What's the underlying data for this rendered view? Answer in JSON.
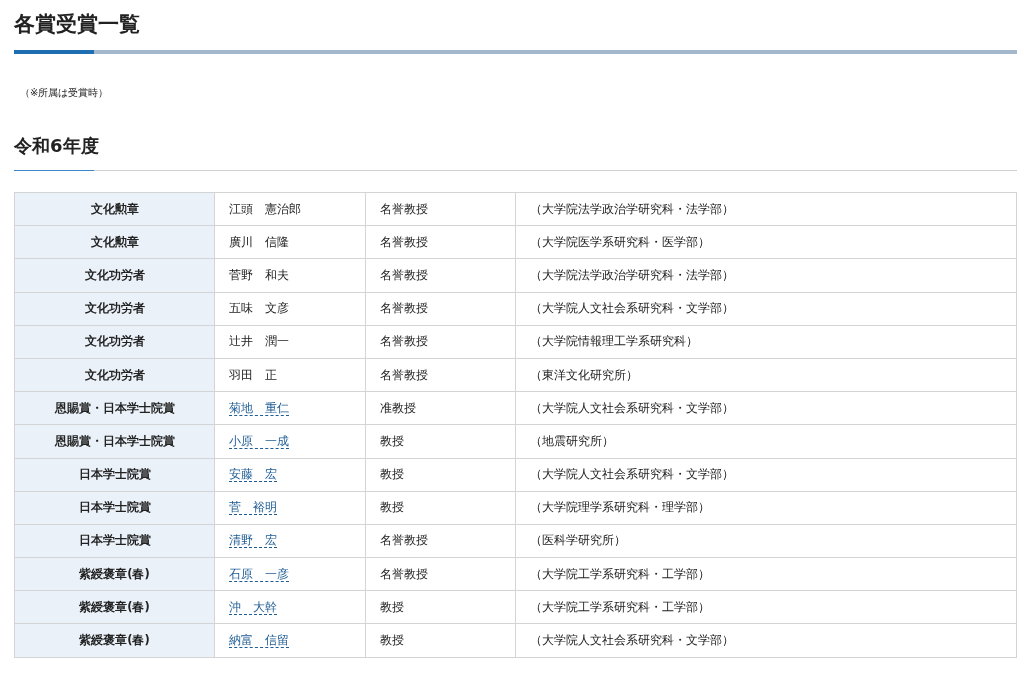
{
  "page_title": "各賞受賞一覧",
  "note": "（※所属は受賞時）",
  "section_title": "令和6年度",
  "table": {
    "rows": [
      {
        "award": "文化勲章",
        "name": "江頭　憲治郎",
        "linked": false,
        "position": "名誉教授",
        "affiliation": "（大学院法学政治学研究科・法学部）"
      },
      {
        "award": "文化勲章",
        "name": "廣川　信隆",
        "linked": false,
        "position": "名誉教授",
        "affiliation": "（大学院医学系研究科・医学部）"
      },
      {
        "award": "文化功労者",
        "name": "菅野　和夫",
        "linked": false,
        "position": "名誉教授",
        "affiliation": "（大学院法学政治学研究科・法学部）"
      },
      {
        "award": "文化功労者",
        "name": "五味　文彦",
        "linked": false,
        "position": "名誉教授",
        "affiliation": "（大学院人文社会系研究科・文学部）"
      },
      {
        "award": "文化功労者",
        "name": "辻井　潤一",
        "linked": false,
        "position": "名誉教授",
        "affiliation": "（大学院情報理工学系研究科）"
      },
      {
        "award": "文化功労者",
        "name": "羽田　正",
        "linked": false,
        "position": "名誉教授",
        "affiliation": "（東洋文化研究所）"
      },
      {
        "award": "恩賜賞・日本学士院賞",
        "name": "菊地　重仁",
        "linked": true,
        "position": "准教授",
        "affiliation": "（大学院人文社会系研究科・文学部）"
      },
      {
        "award": "恩賜賞・日本学士院賞",
        "name": "小原　一成",
        "linked": true,
        "position": "教授",
        "affiliation": "（地震研究所）"
      },
      {
        "award": "日本学士院賞",
        "name": "安藤　宏",
        "linked": true,
        "position": "教授",
        "affiliation": "（大学院人文社会系研究科・文学部）"
      },
      {
        "award": "日本学士院賞",
        "name": "菅　裕明",
        "linked": true,
        "position": "教授",
        "affiliation": "（大学院理学系研究科・理学部）"
      },
      {
        "award": "日本学士院賞",
        "name": "清野　宏",
        "linked": true,
        "position": "名誉教授",
        "affiliation": "（医科学研究所）"
      },
      {
        "award": "紫綬褒章(春)",
        "name": "石原　一彦",
        "linked": true,
        "position": "名誉教授",
        "affiliation": "（大学院工学系研究科・工学部）"
      },
      {
        "award": "紫綬褒章(春)",
        "name": "沖　大幹",
        "linked": true,
        "position": "教授",
        "affiliation": "（大学院工学系研究科・工学部）"
      },
      {
        "award": "紫綬褒章(春)",
        "name": "納富　信留",
        "linked": true,
        "position": "教授",
        "affiliation": "（大学院人文社会系研究科・文学部）"
      }
    ]
  }
}
